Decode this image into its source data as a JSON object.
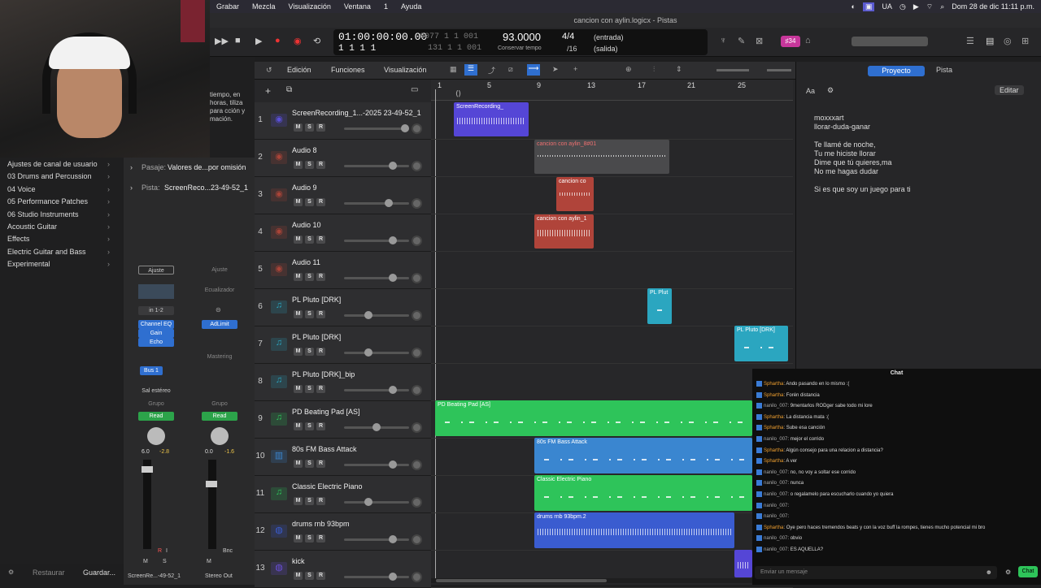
{
  "menubar": {
    "items": [
      "Grabar",
      "Mezcla",
      "Visualización",
      "Ventana",
      "1",
      "Ayuda"
    ],
    "right_ua": "UA",
    "datetime": "Dom 28 de dic  11:11 p.m."
  },
  "window": {
    "title": "cancion con aylin.logicx - Pistas"
  },
  "lcd": {
    "time": "01:00:00:00.00",
    "bars_top": "0077  1  1  001",
    "bars_bottom": "1  1  1  1",
    "bars_bottom2": "131  1  1  001",
    "tempo": "93.0000",
    "tempo_label": "Conservar tempo",
    "sig": "4/4",
    "div": "/16",
    "in": "(entrada)",
    "out": "(salida)"
  },
  "badge": "♯34",
  "library": {
    "text": "tiempo, en horas, tiliza para cción y mación.",
    "items": [
      "Ajustes de canal de usuario",
      "03 Drums and Percussion",
      "04 Voice",
      "05 Performance Patches",
      "06 Studio Instruments",
      "Acoustic Guitar",
      "Effects",
      "Electric Guitar and Bass",
      "Experimental"
    ],
    "restore": "Restaurar",
    "save": "Guardar..."
  },
  "inspector": {
    "pasaje_label": "Pasaje:",
    "pasaje_value": "Valores de...por omisión",
    "pista_label": "Pista:",
    "pista_value": "ScreenReco...23-49-52_1",
    "strip1": {
      "setting": "Ajuste",
      "io": "in 1-2",
      "plugins": [
        "Channel EQ",
        "Gain",
        "Echo"
      ],
      "bus": "Bus 1",
      "out": "Sal estéreo",
      "group": "Grupo",
      "read": "Read",
      "vol": "6.0",
      "peak": "-2.8",
      "name": "ScreenRe...-49-52_1",
      "m": "M",
      "s": "S",
      "r": "R",
      "i": "I"
    },
    "strip2": {
      "setting": "Ajuste",
      "eq": "Ecualizador",
      "plugins": [
        "AdLimit"
      ],
      "master": "Mastering",
      "group": "Grupo",
      "read": "Read",
      "vol": "0.0",
      "peak": "-1.6",
      "name": "Stereo Out",
      "m": "M",
      "bnc": "Bnc"
    }
  },
  "toolbar": {
    "edit": "Edición",
    "functions": "Funciones",
    "view": "Visualización"
  },
  "ruler": [
    "1",
    "5",
    "9",
    "13",
    "17",
    "21",
    "25"
  ],
  "tracks": [
    {
      "n": "1",
      "name": "ScreenRecording_1...-2025 23-49-52_1",
      "color": "#5a4fd8",
      "type": "audio"
    },
    {
      "n": "2",
      "name": "Audio 8",
      "color": "#a84438",
      "type": "audio"
    },
    {
      "n": "3",
      "name": "Audio 9",
      "color": "#a84438",
      "type": "audio"
    },
    {
      "n": "4",
      "name": "Audio 10",
      "color": "#a84438",
      "type": "audio"
    },
    {
      "n": "5",
      "name": "Audio 11",
      "color": "#a84438",
      "type": "audio"
    },
    {
      "n": "6",
      "name": "PL Pluto [DRK]",
      "color": "#2ba6c0",
      "type": "inst"
    },
    {
      "n": "7",
      "name": "PL Pluto [DRK]",
      "color": "#2ba6c0",
      "type": "inst"
    },
    {
      "n": "8",
      "name": "PL Pluto [DRK]_bip",
      "color": "#2ba6c0",
      "type": "inst"
    },
    {
      "n": "9",
      "name": "PD Beating Pad [AS]",
      "color": "#2ec45a",
      "type": "inst"
    },
    {
      "n": "10",
      "name": "80s FM Bass Attack",
      "color": "#3a86d0",
      "type": "keys"
    },
    {
      "n": "11",
      "name": "Classic Electric Piano",
      "color": "#2ec45a",
      "type": "inst"
    },
    {
      "n": "12",
      "name": "drums rnb 93bpm",
      "color": "#3a5cd0",
      "type": "drum"
    },
    {
      "n": "13",
      "name": "kick",
      "color": "#6a4fd8",
      "type": "drum"
    }
  ],
  "regions": {
    "r1": "ScreenRecording_",
    "r2": "cancion con aylin_8#01",
    "r3": "cancion co",
    "r4": "cancion con aylin_1",
    "r5": "PL Plut",
    "r6": "PL Pluto [DRK]",
    "r7": "PD Beating Pad [AS]",
    "r8": "80s FM Bass Attack",
    "r9": "Classic Electric Piano",
    "r10": "drums rnb 93bpm.2"
  },
  "btn": {
    "m": "M",
    "s": "S",
    "r": "R"
  },
  "right": {
    "tab_project": "Proyecto",
    "tab_track": "Pista",
    "aa": "Aa",
    "edit": "Editar",
    "lyrics": [
      "moxxxart",
      "llorar-duda-ganar",
      "",
      "Te llamé de noche,",
      "Tu me hiciste llorar",
      "Dime que tú quieres,ma",
      "No me hagas dudar",
      "",
      "Si es que soy un juego para ti"
    ]
  },
  "chat": {
    "title": "Chat",
    "messages": [
      {
        "u": "Sphartha",
        "c": "u1",
        "t": "Ando pasando en lo mismo :("
      },
      {
        "u": "Sphartha",
        "c": "u1",
        "t": "Forén distancia"
      },
      {
        "u": "nanilo_007",
        "c": "u2",
        "t": "9mentarlos RODger sabe todo mi lore"
      },
      {
        "u": "Sphartha",
        "c": "u1",
        "t": "La distancia mata :("
      },
      {
        "u": "Sphartha",
        "c": "u1",
        "t": "Sube esa canción"
      },
      {
        "u": "nanilo_007",
        "c": "u2",
        "t": "mejor el corrido"
      },
      {
        "u": "Sphartha",
        "c": "u1",
        "t": "Algún consejo para una relacion a distancia?"
      },
      {
        "u": "Sphartha",
        "c": "u1",
        "t": "A ver"
      },
      {
        "u": "nanilo_007",
        "c": "u2",
        "t": "no, no voy a soltar ese corrido"
      },
      {
        "u": "nanilo_007",
        "c": "u2",
        "t": "nunca"
      },
      {
        "u": "nanilo_007",
        "c": "u2",
        "t": "o regalamelo para escucharlo cuando yo quiera"
      },
      {
        "u": "nanilo_007",
        "c": "u2",
        "t": ""
      },
      {
        "u": "nanilo_007",
        "c": "u2",
        "t": ""
      },
      {
        "u": "Sphartha",
        "c": "u1",
        "t": "Oye pero haces tremendos beats y con la voz buff la rompes, tienes mucho potencial mi bro"
      },
      {
        "u": "nanilo_007",
        "c": "u2",
        "t": "obvio"
      },
      {
        "u": "nanilo_007",
        "c": "u2",
        "t": "ES AQUELLA?"
      }
    ],
    "placeholder": "Enviar un mensaje",
    "send": "Chat"
  }
}
